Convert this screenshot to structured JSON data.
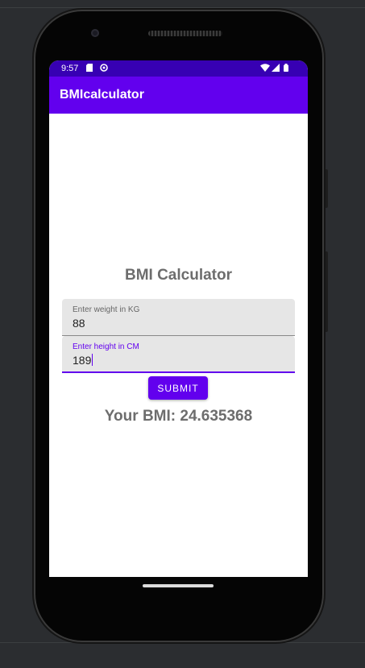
{
  "status_bar": {
    "time": "9:57",
    "icons": [
      "sd-card-icon",
      "notification-icon",
      "wifi-icon",
      "signal-icon",
      "battery-icon"
    ]
  },
  "app_bar": {
    "title": "BMIcalculator"
  },
  "main": {
    "heading": "BMI Calculator",
    "weight_field": {
      "label": "Enter weight in KG",
      "value": "88"
    },
    "height_field": {
      "label": "Enter height in CM",
      "value": "189"
    },
    "submit_label": "SUBMIT",
    "result": "Your BMI: 24.635368"
  },
  "colors": {
    "status_bar": "#3700b3",
    "app_bar": "#6200ee",
    "accent": "#6200ee",
    "text_gray": "#6d6d6d"
  }
}
